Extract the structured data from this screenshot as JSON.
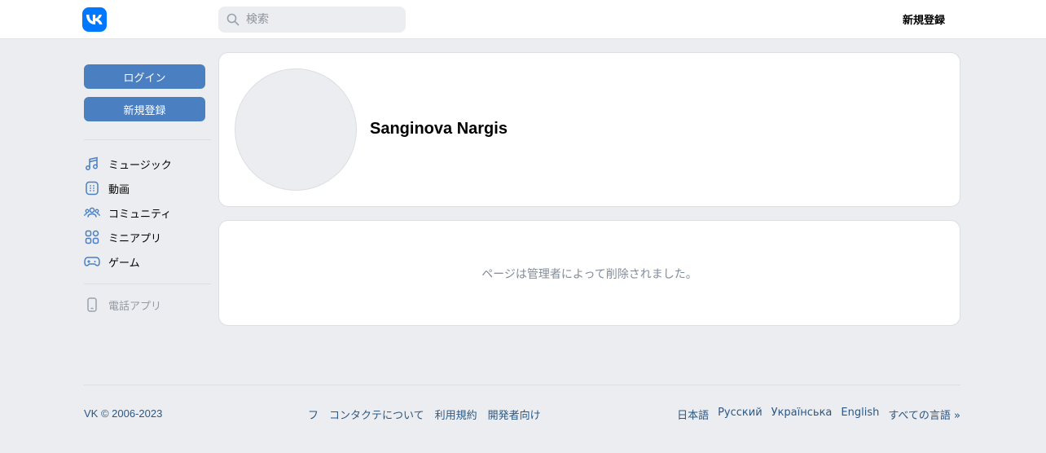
{
  "header": {
    "search_placeholder": "検索",
    "signup_label": "新規登録"
  },
  "sidebar": {
    "login_label": "ログイン",
    "signup_label": "新規登録",
    "items": [
      {
        "label": "ミュージック",
        "icon": "music-icon"
      },
      {
        "label": "動画",
        "icon": "video-icon"
      },
      {
        "label": "コミュニティ",
        "icon": "community-icon"
      },
      {
        "label": "ミニアプリ",
        "icon": "mini-apps-icon"
      },
      {
        "label": "ゲーム",
        "icon": "gamepad-icon"
      }
    ],
    "phone_app": {
      "label": "電話アプリ",
      "icon": "phone-icon"
    }
  },
  "profile": {
    "name": "Sanginova Nargis",
    "deleted_message": "ページは管理者によって削除されました。"
  },
  "footer": {
    "copyright": "VK © 2006-2023",
    "links": [
      "フ",
      "コンタクテについて",
      "利用規約",
      "開発者向け"
    ],
    "languages": [
      "日本語",
      "Русский",
      "Українська",
      "English",
      "すべての言語 »"
    ]
  },
  "colors": {
    "brand": "#0077ff",
    "button": "#4a7fc1",
    "link": "#2a5885",
    "background": "#ebedf0"
  }
}
